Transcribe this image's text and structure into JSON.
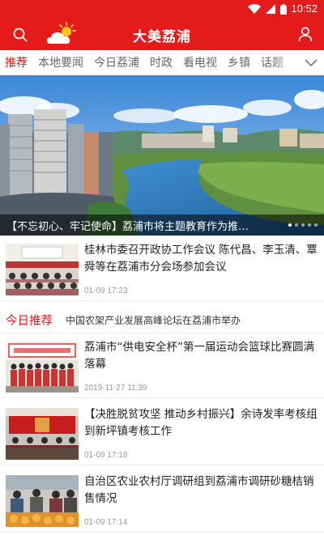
{
  "status_bar": {
    "time": "10:52"
  },
  "header": {
    "title": "大美荔浦"
  },
  "tabs": [
    {
      "label": "推荐",
      "active": true
    },
    {
      "label": "本地要闻"
    },
    {
      "label": "今日荔浦"
    },
    {
      "label": "时政"
    },
    {
      "label": "看电视"
    },
    {
      "label": "乡镇"
    },
    {
      "label": "话题"
    }
  ],
  "hero": {
    "caption": "【不忘初心、牢记使命】荔浦市将主题教育作为推…",
    "slide_count": 5,
    "active_slide": 1
  },
  "news": [
    {
      "title": "桂林市委召开政协工作会议 陈代昌、李玉清、覃舜等在荔浦市分会场参加会议",
      "date": "01-09 17:23"
    },
    {
      "title": "荔浦市“供电安全杯”第一届运动会篮球比赛圆满落幕",
      "date": "2019-11-27 11:39"
    },
    {
      "title": "【决胜脱贫攻坚 推动乡村振兴】余诗发率考核组到新坪镇考核工作",
      "date": "01-09 17:18"
    },
    {
      "title": "自治区农业农村厅调研组到荔浦市调研砂糖桔销售情况",
      "date": "01-09 17:14"
    }
  ],
  "recommend": {
    "label": "今日推荐",
    "text": "中国农架产业发展高峰论坛在荔浦市举办"
  },
  "colors": {
    "brand_red": "#e51a1a",
    "text_gray": "#666666",
    "date_gray": "#999999"
  },
  "icons": {
    "search": "search-icon",
    "weather": "weather-icon",
    "user": "user-icon",
    "more_tabs": "chevron-down-icon"
  }
}
